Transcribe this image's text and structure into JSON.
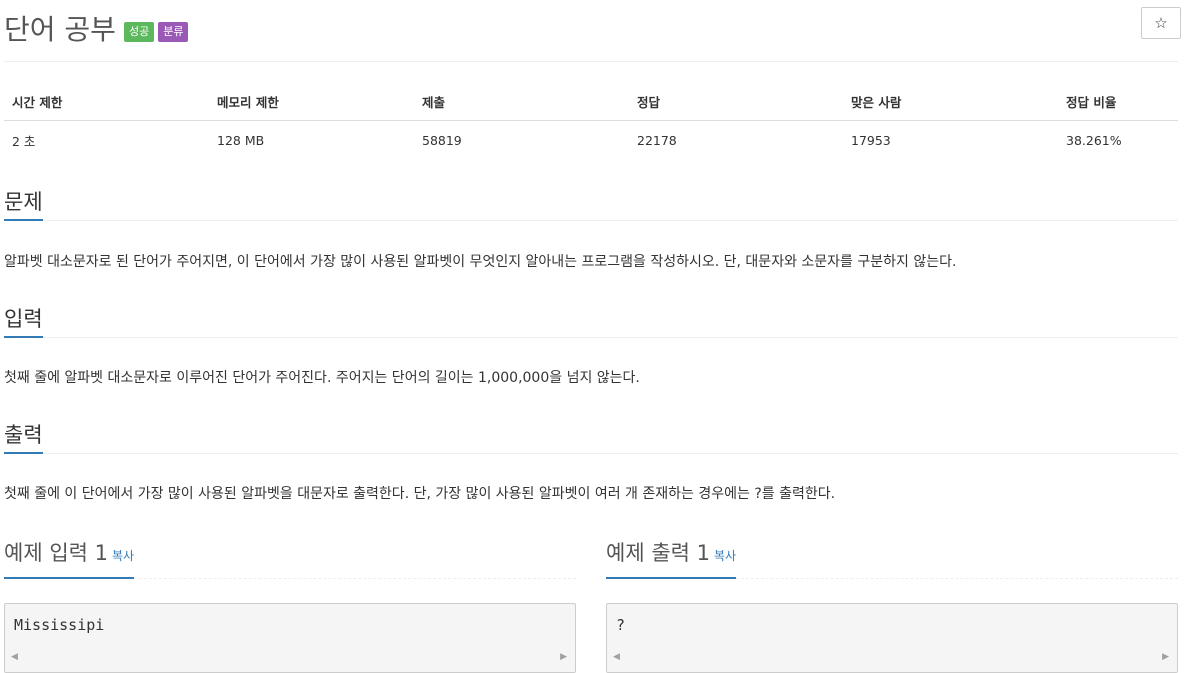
{
  "header": {
    "title": "단어 공부",
    "badge_success": "성공",
    "badge_category": "분류",
    "star_icon": "☆"
  },
  "stats": {
    "headers": [
      "시간 제한",
      "메모리 제한",
      "제출",
      "정답",
      "맞은 사람",
      "정답 비율"
    ],
    "values": [
      "2 초",
      "128 MB",
      "58819",
      "22178",
      "17953",
      "38.261%"
    ]
  },
  "problem": {
    "title": "문제",
    "text": "알파벳 대소문자로 된 단어가 주어지면, 이 단어에서 가장 많이 사용된 알파벳이 무엇인지 알아내는 프로그램을 작성하시오. 단, 대문자와 소문자를 구분하지 않는다."
  },
  "input": {
    "title": "입력",
    "text": "첫째 줄에 알파벳 대소문자로 이루어진 단어가 주어진다. 주어지는 단어의 길이는 1,000,000을 넘지 않는다."
  },
  "output": {
    "title": "출력",
    "text": "첫째 줄에 이 단어에서 가장 많이 사용된 알파벳을 대문자로 출력한다. 단, 가장 많이 사용된 알파벳이 여러 개 존재하는 경우에는 ?를 출력한다."
  },
  "sample_input": {
    "title": "예제 입력 1",
    "copy_label": "복사",
    "code": "Mississipi"
  },
  "sample_output": {
    "title": "예제 출력 1",
    "copy_label": "복사",
    "code": "?"
  },
  "icons": {
    "star": "star-icon",
    "scroll_left": "chevron-left-icon",
    "scroll_right": "chevron-right-icon"
  }
}
